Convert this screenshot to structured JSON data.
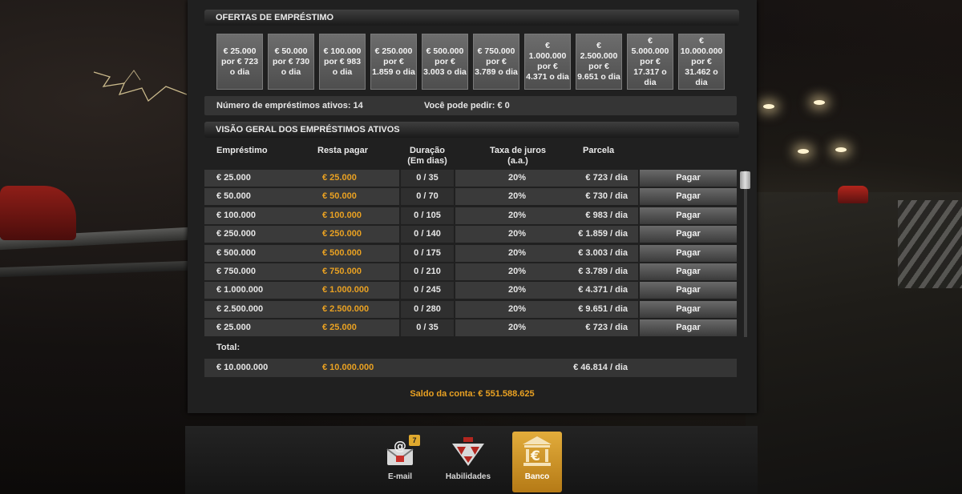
{
  "offers_section": {
    "title": "OFERTAS DE EMPRÉSTIMO",
    "offers": [
      "€ 25.000 por € 723 o dia",
      "€ 50.000 por € 730 o dia",
      "€ 100.000 por € 983 o dia",
      "€ 250.000 por € 1.859 o dia",
      "€ 500.000 por € 3.003 o dia",
      "€ 750.000 por € 3.789 o dia",
      "€ 1.000.000 por € 4.371 o dia",
      "€ 2.500.000 por € 9.651 o dia",
      "€ 5.000.000 por € 17.317 o dia",
      "€ 10.000.000 por € 31.462 o dia"
    ]
  },
  "info": {
    "active_loans": "Número de empréstimos ativos: 14",
    "can_borrow": "Você pode pedir: € 0"
  },
  "overview_section": {
    "title": "VISÃO GERAL DOS EMPRÉSTIMOS ATIVOS",
    "headers": {
      "loan": "Empréstimo",
      "remaining": "Resta pagar",
      "duration": "Duração",
      "duration_sub": "(Em dias)",
      "rate": "Taxa de juros",
      "rate_sub": "(a.a.)",
      "installment": "Parcela"
    },
    "pay_label": "Pagar",
    "rows": [
      {
        "loan": "€ 25.000",
        "remaining": "€ 25.000",
        "duration": "0 / 35",
        "rate": "20%",
        "installment": "€ 723 / dia"
      },
      {
        "loan": "€ 50.000",
        "remaining": "€ 50.000",
        "duration": "0 / 70",
        "rate": "20%",
        "installment": "€ 730 / dia"
      },
      {
        "loan": "€ 100.000",
        "remaining": "€ 100.000",
        "duration": "0 / 105",
        "rate": "20%",
        "installment": "€ 983 / dia"
      },
      {
        "loan": "€ 250.000",
        "remaining": "€ 250.000",
        "duration": "0 / 140",
        "rate": "20%",
        "installment": "€ 1.859 / dia"
      },
      {
        "loan": "€ 500.000",
        "remaining": "€ 500.000",
        "duration": "0 / 175",
        "rate": "20%",
        "installment": "€ 3.003 / dia"
      },
      {
        "loan": "€ 750.000",
        "remaining": "€ 750.000",
        "duration": "0 / 210",
        "rate": "20%",
        "installment": "€ 3.789 / dia"
      },
      {
        "loan": "€ 1.000.000",
        "remaining": "€ 1.000.000",
        "duration": "0 / 245",
        "rate": "20%",
        "installment": "€ 4.371 / dia"
      },
      {
        "loan": "€ 2.500.000",
        "remaining": "€ 2.500.000",
        "duration": "0 / 280",
        "rate": "20%",
        "installment": "€ 9.651 / dia"
      },
      {
        "loan": "€ 25.000",
        "remaining": "€ 25.000",
        "duration": "0 / 35",
        "rate": "20%",
        "installment": "€ 723 / dia"
      }
    ],
    "total_label": "Total:",
    "total": {
      "loan": "€ 10.000.000",
      "remaining": "€ 10.000.000",
      "installment": "€ 46.814 / dia"
    }
  },
  "balance": "Saldo da conta: € 551.588.625",
  "dock": {
    "email_label": "E-mail",
    "email_badge": "7",
    "skills_label": "Habilidades",
    "bank_label": "Banco"
  },
  "colors": {
    "accent_orange": "#e9a122",
    "active_tab": "#d39b2c"
  }
}
